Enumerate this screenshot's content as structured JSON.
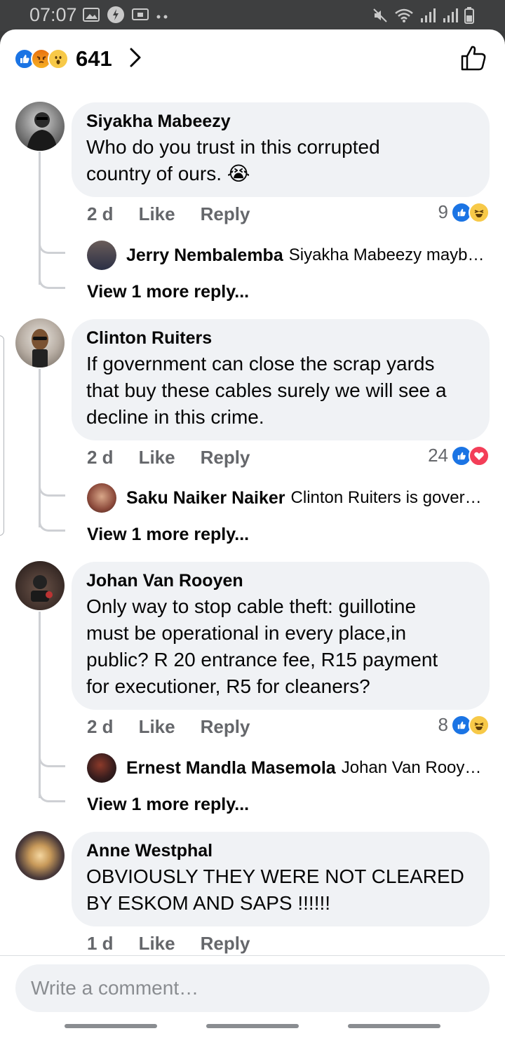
{
  "status_bar": {
    "time": "07:07"
  },
  "header": {
    "reaction_count": "641",
    "reactions": [
      "like-icon",
      "angry-icon",
      "wow-icon"
    ]
  },
  "comments": [
    {
      "name": "Siyakha Mabeezy",
      "lines": [
        "Who do you trust in this corrupted",
        "country of ours. 😭"
      ],
      "time": "2 d",
      "like": "Like",
      "reply": "Reply",
      "reaction_count": "9",
      "reactions": [
        "like",
        "haha"
      ],
      "reply_preview": {
        "name": "Jerry Nembalemba",
        "text": "Siyakha Mabeezy mayb…"
      },
      "more": "View 1 more reply..."
    },
    {
      "name": "Clinton Ruiters",
      "lines": [
        "If government can close the scrap yards",
        "that buy these cables surely we will see a",
        "decline in this crime."
      ],
      "time": "2 d",
      "like": "Like",
      "reply": "Reply",
      "reaction_count": "24",
      "reactions": [
        "like",
        "love"
      ],
      "reply_preview": {
        "name": "Saku Naiker Naiker",
        "text": "Clinton Ruiters is gover…"
      },
      "more": "View 1 more reply..."
    },
    {
      "name": "Johan Van Rooyen",
      "lines": [
        "Only way to stop cable theft: guillotine",
        "must be operational in every place,in",
        "public? R 20 entrance fee, R15 payment",
        "for executioner, R5 for cleaners?"
      ],
      "time": "2 d",
      "like": "Like",
      "reply": "Reply",
      "reaction_count": "8",
      "reactions": [
        "like",
        "haha"
      ],
      "reply_preview": {
        "name": "Ernest Mandla Masemola",
        "text": "Johan Van Rooy…"
      },
      "more": "View 1 more reply..."
    },
    {
      "name": "Anne Westphal",
      "lines": [
        "OBVIOUSLY THEY WERE NOT CLEARED",
        "BY ESKOM AND SAPS !!!!!!"
      ],
      "time": "1 d",
      "like": "Like",
      "reply": "Reply"
    }
  ],
  "composer": {
    "placeholder": "Write a comment…"
  },
  "colors": {
    "like_blue": "#1b74e4",
    "love_red": "#f33e58",
    "haha_yellow": "#f7c948",
    "bubble_bg": "#f0f2f5",
    "meta_gray": "#65676b"
  }
}
